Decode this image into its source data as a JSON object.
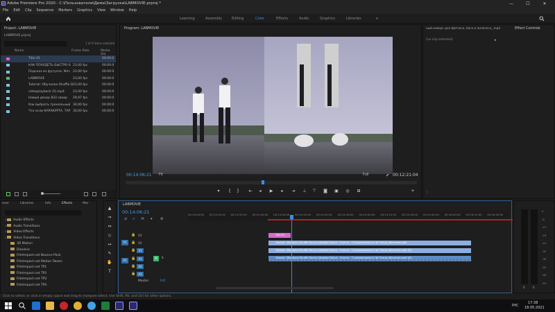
{
  "window": {
    "title": "Adobe Premiere Pro 2020 - C:\\Пользователи\\Дима\\Загрузки\\LABMOVIE.prproj *",
    "min": "—",
    "max": "☐",
    "close": "✕"
  },
  "menu": [
    "File",
    "Edit",
    "Clip",
    "Sequence",
    "Markers",
    "Graphics",
    "View",
    "Window",
    "Help"
  ],
  "workspaces": [
    {
      "label": "Learning"
    },
    {
      "label": "Assembly"
    },
    {
      "label": "Editing"
    },
    {
      "label": "Color"
    },
    {
      "label": "Effects"
    },
    {
      "label": "Audio"
    },
    {
      "label": "Graphics"
    },
    {
      "label": "Libraries"
    }
  ],
  "project": {
    "tab": "Project: LABMOVIE",
    "file": "LABMOVIE.prproj",
    "count": "1 of 9 items selected",
    "headers": {
      "name": "Name",
      "frame_rate": "Frame Rate",
      "media_start": "Media Sta"
    },
    "items": [
      {
        "name": "Title 01",
        "fps": "",
        "start": "00:00:0",
        "color": "#e05fc6"
      },
      {
        "name": "КАК ПОХУДЕТЬ БЫСТРО б",
        "fps": "23,00 fps",
        "start": "00:00:0",
        "color": "#7ec3d8"
      },
      {
        "name": "Подсказ из футуспа. Мяч",
        "fps": "23,00 fps",
        "start": "00:00:0",
        "color": "#7ec3d8"
      },
      {
        "name": "LABMOVIE",
        "fps": "23,00 fps",
        "start": "00:00:0",
        "color": "#4fbf5e"
      },
      {
        "name": "Tutorial: Обучалка Shuffle D",
        "fps": "23,00 fps",
        "start": "00:00:0",
        "color": "#7ec3d8"
      },
      {
        "name": "videoplayback (5).mp4",
        "fps": "23,00 fps",
        "start": "00:00:0",
        "color": "#7ec3d8"
      },
      {
        "name": "Новый декор 833 своир",
        "fps": "29,97 fps",
        "start": "00:00:0",
        "color": "#7ec3d8"
      },
      {
        "name": "Как выбрать тренельный",
        "fps": "30,00 fps",
        "start": "00:00:0",
        "color": "#7ec3d8"
      },
      {
        "name": "Что если КАРАКУРТА. ТАР",
        "fps": "30,00 fps",
        "start": "00:00:0",
        "color": "#7ec3d8"
      }
    ]
  },
  "program": {
    "tab": "Program: LABMOVIE",
    "timecode": "00:14:06:21",
    "fit": "Fit",
    "full": "Full",
    "duration": "00:12:21:04"
  },
  "source_tab": "ный инверс для фитнеса, йоги и пилатеса_.mp4",
  "effect_controls": {
    "tab": "Effect Controls",
    "noclip": "(no clip selected)"
  },
  "effects": {
    "tabs": [
      "ever",
      "Libraries",
      "Info",
      "Effects",
      "Mar"
    ],
    "tree": [
      {
        "label": "Audio Effects",
        "depth": 0
      },
      {
        "label": "Audio Transitions",
        "depth": 0
      },
      {
        "label": "Video Effects",
        "depth": 0
      },
      {
        "label": "Video Transitions",
        "depth": 0
      },
      {
        "label": "3D Motion",
        "depth": 1
      },
      {
        "label": "Dissolve",
        "depth": 1
      },
      {
        "label": "FilmImpact.net Bounce Pack",
        "depth": 1
      },
      {
        "label": "FilmImpact.net Motion Tween",
        "depth": 1
      },
      {
        "label": "FilmImpact.net TP1",
        "depth": 1
      },
      {
        "label": "FilmImpact.net TP2",
        "depth": 1
      },
      {
        "label": "FilmImpact.net TP3",
        "depth": 1
      },
      {
        "label": "FilmImpact.net TP4",
        "depth": 1
      }
    ]
  },
  "timeline": {
    "tab": "LABMOVIE",
    "timecode": "00:14:06:21",
    "ticks": [
      "00:13:00:00",
      "00:13:15:00",
      "00:13:30:00",
      "00:13:45:00",
      "00:14:00:00",
      "00:14:15:00",
      "00:14:30:00",
      "00:14:45:00",
      "00:15:00:00",
      "00:15:15:00",
      "00:15:30:00",
      "00:15:45:00",
      "00:16:00:00",
      "00:16:15:00",
      "00:16:30:00"
    ],
    "tracks": {
      "v3": "V3",
      "v2": "V2",
      "v1": "V1",
      "a1": "A1",
      "a2": "A2",
      "a3": "A3",
      "master": "Master",
      "master_val": "0.0",
      "src_v": "V1",
      "src_a": "A1"
    },
    "clips": {
      "title": "Title 01",
      "v2": "Tutorial: Обучалка Shuffle Dance (Шаффл Dance - Учится - Туториал(минута 3и Танцы обучения.mp4",
      "v1": "Tutorial: Обучалка Shuffle Dance (Шаффл Dance - Учится - Туториал(минута 3и Танцы обучения.mp4 [V]",
      "a1": "Tutorial: Обучалка Shuffle Dance (Шаффл Dance - Учится - Туториал(минута 3и Танцы обучения.mp4 [A]"
    },
    "track_letters": {
      "m": "M",
      "s": "S"
    }
  },
  "audio_meter": {
    "scale": [
      "0",
      "-6",
      "-12",
      "-18",
      "-24",
      "-30",
      "-36",
      "-42",
      "-48",
      "-54"
    ],
    "labels": [
      "S",
      "S"
    ]
  },
  "statusbar": "Click to select, or click in empty space and drag to marquee select. Use Shift, Alt, and Ctrl for other options.",
  "taskbar": {
    "lang": "РУС",
    "time": "17:38",
    "date": "18.05.2021"
  }
}
